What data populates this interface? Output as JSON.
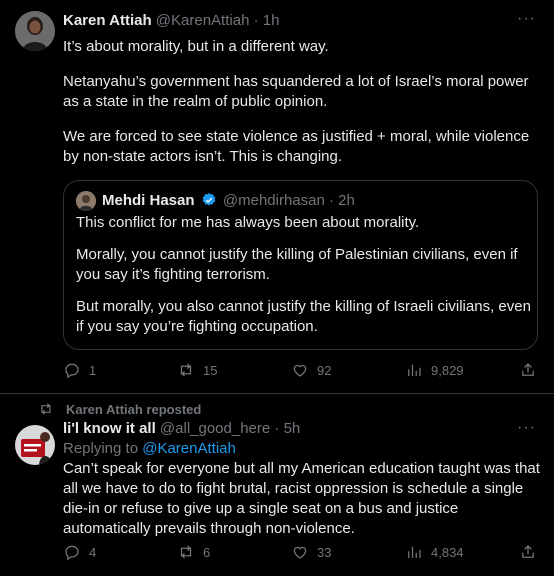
{
  "tweet1": {
    "author_name": "Karen Attiah",
    "author_handle": "@KarenAttiah",
    "separator": "·",
    "time": "1h",
    "more": "···",
    "text_p1": "It’s about morality, but in a different way.",
    "text_p2": "Netanyahu’s government has squandered a lot of Israel’s moral power as a state in the realm of public opinion.",
    "text_p3": "We are forced to see state violence as justified + moral, while violence by non-state actors isn’t. This is changing.",
    "quote": {
      "author_name": "Mehdi Hasan",
      "author_handle": "@mehdirhasan",
      "separator": "·",
      "time": "2h",
      "text_p1": "This conflict for me has always been about morality.",
      "text_p2": "Morally, you cannot justify the killing of Palestinian civilians, even if you say it’s fighting terrorism.",
      "text_p3": "But morally, you also cannot justify the killing of Israeli civilians, even if you say you’re fighting occupation."
    },
    "actions": {
      "replies": "1",
      "reposts": "15",
      "likes": "92",
      "views": "9,829"
    }
  },
  "repost_banner": {
    "text": "Karen Attiah reposted"
  },
  "tweet2": {
    "author_name": "li'l know it all",
    "author_handle": "@all_good_here",
    "separator": "·",
    "time": "5h",
    "more": "···",
    "replying_prefix": "Replying to",
    "replying_handle": "@KarenAttiah",
    "text": "Can’t speak for everyone but all my American education taught was that all we have to do to fight brutal, racist oppression is schedule a single die-in or refuse to give up a single seat on a bus and justice automatically prevails through non-violence.",
    "actions": {
      "replies": "4",
      "reposts": "6",
      "likes": "33",
      "views": "4,834"
    }
  },
  "icons": {
    "reply": "reply-icon",
    "repost": "repost-icon",
    "like": "heart-icon",
    "views": "views-icon",
    "share": "share-icon",
    "verified": "verified-badge-icon"
  },
  "colors": {
    "background": "#000000",
    "text": "#e7e9ea",
    "muted": "#71767b",
    "link": "#1d9bf0",
    "verified": "#1d9bf0",
    "border": "#2f3336"
  }
}
